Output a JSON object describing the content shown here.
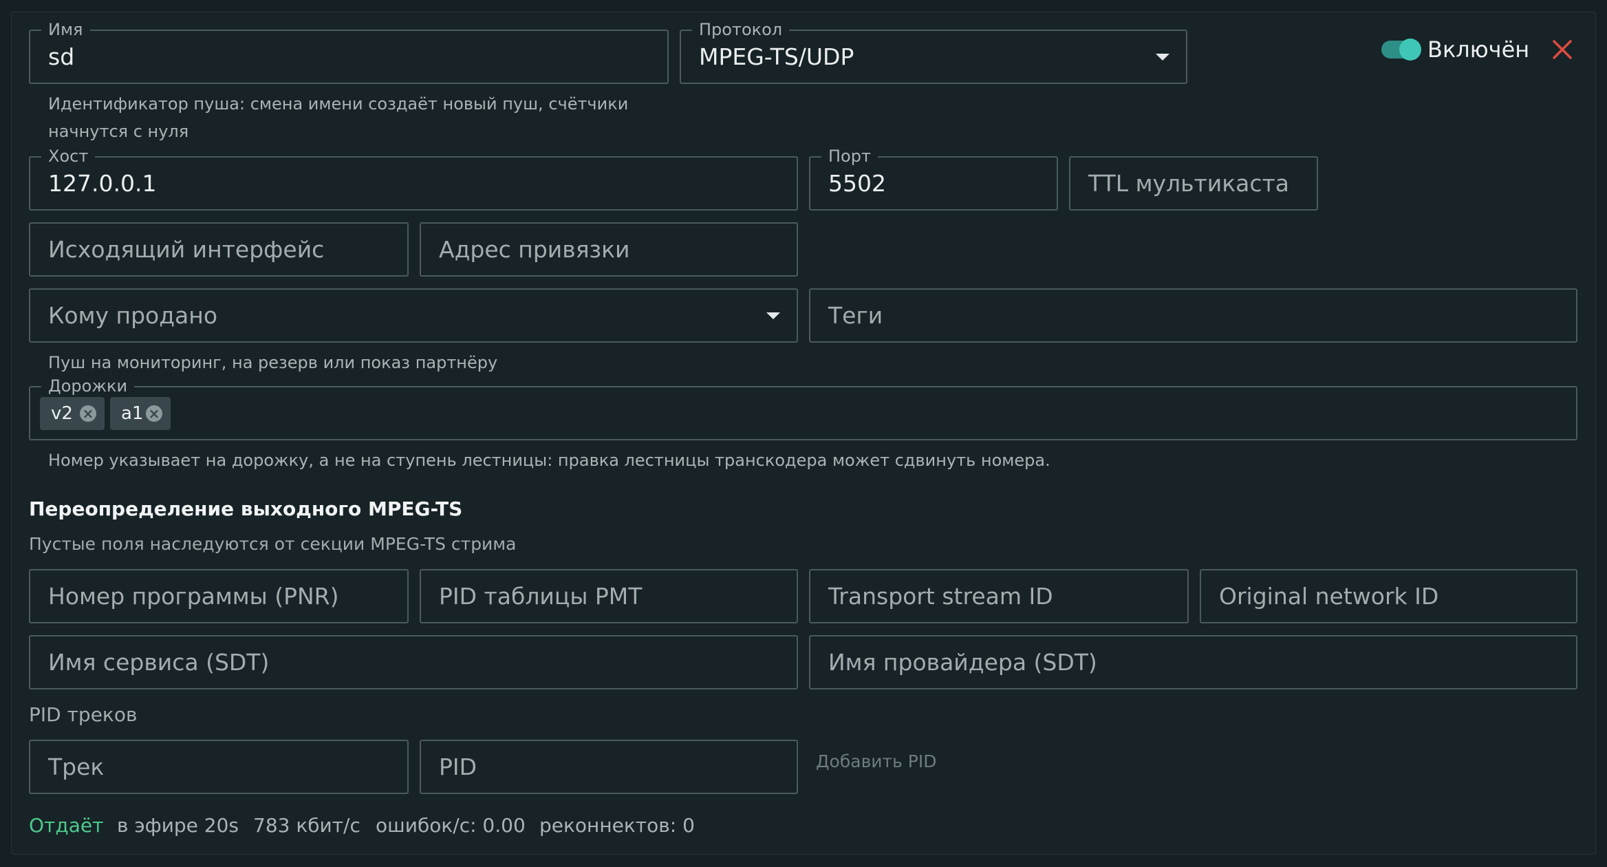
{
  "name": {
    "label": "Имя",
    "value": "sd",
    "helper_line1": "Идентификатор пуша: смена имени создаёт новый пуш, счётчики",
    "helper_line2": "начнутся с нуля"
  },
  "protocol": {
    "label": "Протокол",
    "value": "MPEG-TS/UDP"
  },
  "enabled": {
    "label": "Включён",
    "on": true
  },
  "host": {
    "label": "Хост",
    "value": "127.0.0.1"
  },
  "port": {
    "label": "Порт",
    "value": "5502"
  },
  "ttl": {
    "placeholder": "TTL мультикаста"
  },
  "out_iface": {
    "placeholder": "Исходящий интерфейс"
  },
  "bind_addr": {
    "placeholder": "Адрес привязки"
  },
  "sold_to": {
    "placeholder": "Кому продано",
    "helper": "Пуш на мониторинг, на резерв или показ партнёру"
  },
  "tags": {
    "placeholder": "Теги"
  },
  "tracks": {
    "label": "Дорожки",
    "chips": [
      "v2",
      "a1"
    ],
    "helper": "Номер указывает на дорожку, а не на ступень лестницы: правка лестницы транскодера может сдвинуть номера."
  },
  "override": {
    "title": "Переопределение выходного MPEG-TS",
    "subtitle": "Пустые поля наследуются от секции MPEG-TS стрима",
    "pnr": "Номер программы (PNR)",
    "pmt_pid": "PID таблицы PMT",
    "tsid": "Transport stream ID",
    "onid": "Original network ID",
    "service_name": "Имя сервиса (SDT)",
    "provider_name": "Имя провайдера (SDT)"
  },
  "track_pids": {
    "label": "PID треков",
    "track_placeholder": "Трек",
    "pid_placeholder": "PID",
    "add_label": "Добавить PID"
  },
  "status": {
    "state": "Отдаёт",
    "uptime": "в эфире 20s",
    "bitrate": "783 кбит/с",
    "errors": "ошибок/с: 0.00",
    "reconnects": "реконнектов: 0"
  },
  "colors": {
    "accent": "#3fc6b6",
    "ok": "#4fc98d",
    "danger": "#e04b3f"
  }
}
